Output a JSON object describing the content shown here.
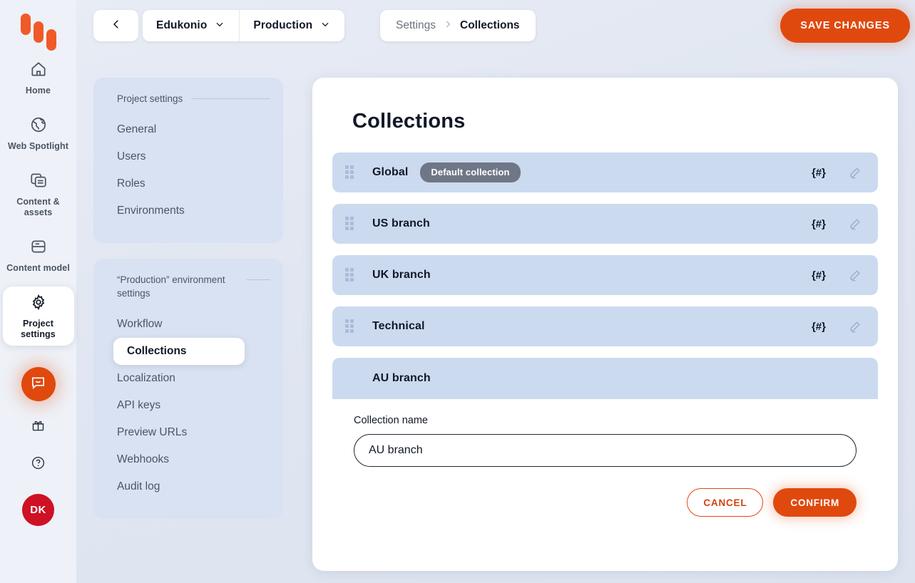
{
  "brand": {
    "logo_name": "kontent-logo",
    "accent": "#e0490d",
    "avatar_color": "#cf1124",
    "row_color": "#ccdaf0",
    "panel_color": "#d9e2f2"
  },
  "rail": {
    "items": [
      {
        "icon": "home-icon",
        "label": "Home",
        "active": false
      },
      {
        "icon": "globe-icon",
        "label": "Web Spotlight",
        "active": false
      },
      {
        "icon": "content-assets-icon",
        "label": "Content & assets",
        "active": false
      },
      {
        "icon": "content-model-icon",
        "label": "Content model",
        "active": false
      },
      {
        "icon": "gear-icon",
        "label": "Project settings",
        "active": true
      }
    ],
    "chat_icon": "chat-bubble-icon",
    "gift_icon": "gift-icon",
    "help_icon": "question-mark-icon",
    "avatar_initials": "DK"
  },
  "topbar": {
    "back_icon": "chevron-left-icon",
    "project_selector": {
      "label": "Edukonio",
      "icon": "chevron-down-icon"
    },
    "environment_selector": {
      "label": "Production",
      "icon": "chevron-down-icon"
    },
    "breadcrumb": {
      "parent": "Settings",
      "separator_icon": "chevron-right-icon",
      "current": "Collections"
    },
    "save_label": "SAVE CHANGES"
  },
  "settings_nav": {
    "project": {
      "heading": "Project settings",
      "items": [
        {
          "label": "General",
          "active": false
        },
        {
          "label": "Users",
          "active": false
        },
        {
          "label": "Roles",
          "active": false
        },
        {
          "label": "Environments",
          "active": false
        }
      ]
    },
    "environment": {
      "heading": "“Production” environment settings",
      "items": [
        {
          "label": "Workflow",
          "active": false
        },
        {
          "label": "Collections",
          "active": true
        },
        {
          "label": "Localization",
          "active": false
        },
        {
          "label": "API keys",
          "active": false
        },
        {
          "label": "Preview URLs",
          "active": false
        },
        {
          "label": "Webhooks",
          "active": false
        },
        {
          "label": "Audit log",
          "active": false
        }
      ]
    }
  },
  "main": {
    "title": "Collections",
    "drag_handle_icon": "drag-handle-icon",
    "codename_icon": "{#}",
    "edit_icon": "pencil-icon",
    "collections": [
      {
        "name": "Global",
        "badge": "Default collection"
      },
      {
        "name": "US branch",
        "badge": ""
      },
      {
        "name": "UK branch",
        "badge": ""
      },
      {
        "name": "Technical",
        "badge": ""
      }
    ],
    "editing": {
      "header_name": "AU branch",
      "field_label": "Collection name",
      "input_value": "AU branch",
      "input_placeholder": "Collection name",
      "cancel_label": "CANCEL",
      "confirm_label": "CONFIRM"
    }
  }
}
